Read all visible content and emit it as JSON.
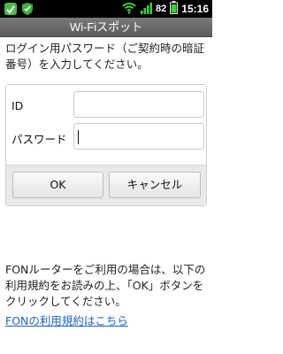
{
  "status_bar": {
    "battery_text": "82",
    "time": "15:16",
    "colors": {
      "background": "#000000",
      "app_icon": "#4db84d"
    },
    "icons": [
      "notification-app-icon",
      "shield-icon",
      "wifi-icon",
      "signal-icon",
      "battery-icon"
    ]
  },
  "title_bar": {
    "title": "Wi-Fiスポット"
  },
  "prompt": {
    "text": "ログイン用パスワード（ご契約時の暗証番号）を入力してください。"
  },
  "form": {
    "id_label": "ID",
    "id_value": "",
    "password_label": "パスワード",
    "password_value": "",
    "ok_label": "OK",
    "cancel_label": "キャンセル"
  },
  "notice": {
    "text": "FONルーターをご利用の場合は、以下の利用規約をお読みの上、「OK」ボタンをクリックしてください。",
    "link_text": "FONの利用規約はこちら",
    "link_color": "#1f62c7"
  }
}
